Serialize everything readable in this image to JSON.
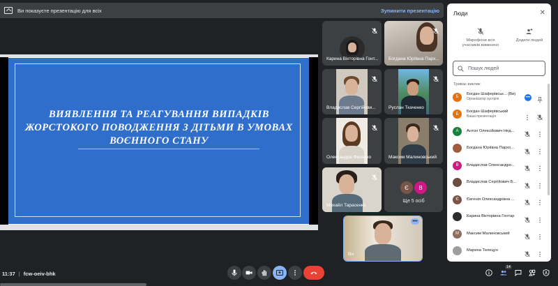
{
  "banner": {
    "text": "Ви показуєте презентацію для всіх",
    "stop_label": "Зупинити презентацію"
  },
  "slide": {
    "title": "ВИЯВЛЕННЯ ТА РЕАГУВАННЯ ВИПАДКІВ ЖОРСТОКОГО ПОВОДЖЕННЯ З ДІТЬМИ В УМОВАХ ВОЄННОГО СТАНУ"
  },
  "tiles": [
    {
      "name": "Карина Вікторівна Гонт..."
    },
    {
      "name": "Богдана Юріївна Парх..."
    },
    {
      "name": "Владислав Сергійови..."
    },
    {
      "name": "Руслан Ткаченко"
    },
    {
      "name": "Олександра Фесенко"
    },
    {
      "name": "Максим Малиновський"
    },
    {
      "name": "Михайл Тарасенко"
    },
    {
      "name": "Ще 5 осіб"
    },
    {
      "name": "Ви"
    }
  ],
  "more_initials": [
    "Є",
    "В"
  ],
  "bottom": {
    "time": "11:37",
    "separator": "|",
    "meeting_code": "fcw-oeiv-bhk",
    "people_count": "14"
  },
  "panel": {
    "title": "Люди",
    "mute_all_label": "Мікрофони всіх учасників вимкнено",
    "add_people_label": "Додати людей",
    "search_placeholder": "Пошук людей",
    "section_label": "Триває виклик",
    "people": [
      {
        "name": "Богдан Шаферівськ... (Ви)",
        "sub": "Організатор зустрічі",
        "initial": "Б",
        "color": "#e8710a"
      },
      {
        "name": "Богдан Шаферівський",
        "sub": "Ваша презентація",
        "initial": "Б",
        "color": "#e8710a"
      },
      {
        "name": "Антон Олексійович Нед...",
        "sub": "",
        "initial": "А",
        "color": "#188038"
      },
      {
        "name": "Богдана Юріївна Пархо...",
        "sub": "",
        "initial": "",
        "color": "#a05a3c"
      },
      {
        "name": "Владислав Олександро...",
        "sub": "",
        "initial": "В",
        "color": "#d01884"
      },
      {
        "name": "Владислав Сергійович Б...",
        "sub": "",
        "initial": "",
        "color": "#6d4c41"
      },
      {
        "name": "Євгенія Олександрівна ...",
        "sub": "",
        "initial": "Є",
        "color": "#795548"
      },
      {
        "name": "Карина Вікторівна Гонтар",
        "sub": "",
        "initial": "",
        "color": "#2d2d2d"
      },
      {
        "name": "Максим Малиновський",
        "sub": "",
        "initial": "М",
        "color": "#8d6e63"
      },
      {
        "name": "Марина Телецун",
        "sub": "",
        "initial": "",
        "color": "#9e9e9e"
      },
      {
        "name": "Михайл Тарасенко",
        "sub": "",
        "initial": "М",
        "color": "#ad1457"
      }
    ]
  }
}
